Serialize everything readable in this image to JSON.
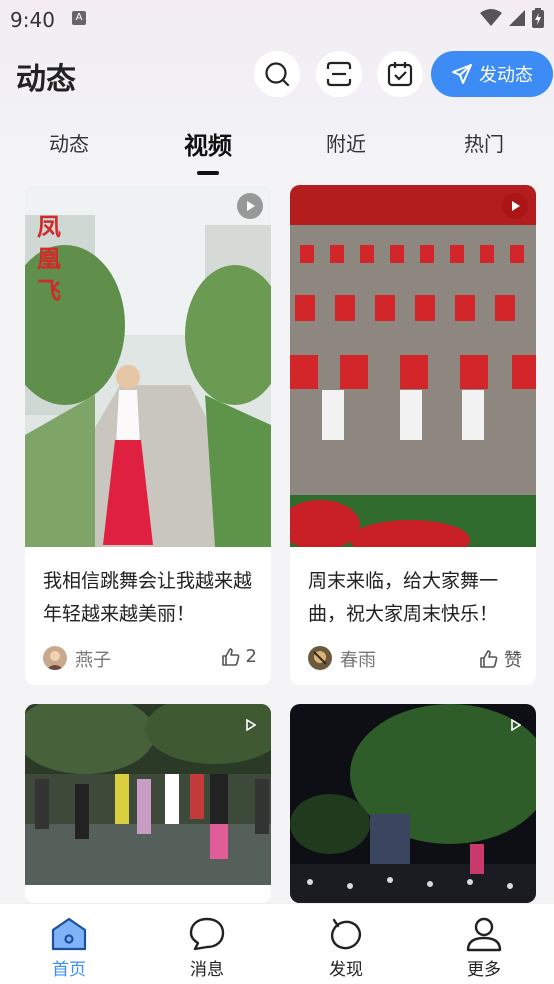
{
  "status_bar": {
    "time": "9:40",
    "notif_letter": "A"
  },
  "header": {
    "title": "动态",
    "post_button_label": "发动态"
  },
  "tabs": [
    {
      "label": "动态",
      "active": false
    },
    {
      "label": "视频",
      "active": true
    },
    {
      "label": "附近",
      "active": false
    },
    {
      "label": "热门",
      "active": false
    }
  ],
  "cards": [
    {
      "thumb_caption": "凤凰飞",
      "text": "我相信跳舞会让我越来越年轻越来越美丽！",
      "author": "燕子",
      "likes": "2"
    },
    {
      "text": "周末来临，给大家舞一曲，祝大家周末快乐！",
      "author": "春雨",
      "likes": "赞"
    },
    {
      "text": "",
      "author": "",
      "likes": ""
    },
    {
      "text": "",
      "author": "",
      "likes": ""
    }
  ],
  "bottom_nav": [
    {
      "label": "首页",
      "icon": "home-icon",
      "active": true
    },
    {
      "label": "消息",
      "icon": "message-icon",
      "active": false
    },
    {
      "label": "发现",
      "icon": "discover-icon",
      "active": false
    },
    {
      "label": "更多",
      "icon": "profile-icon",
      "active": false
    }
  ],
  "colors": {
    "accent": "#3d8cf5",
    "background": "#f4f4f6"
  }
}
